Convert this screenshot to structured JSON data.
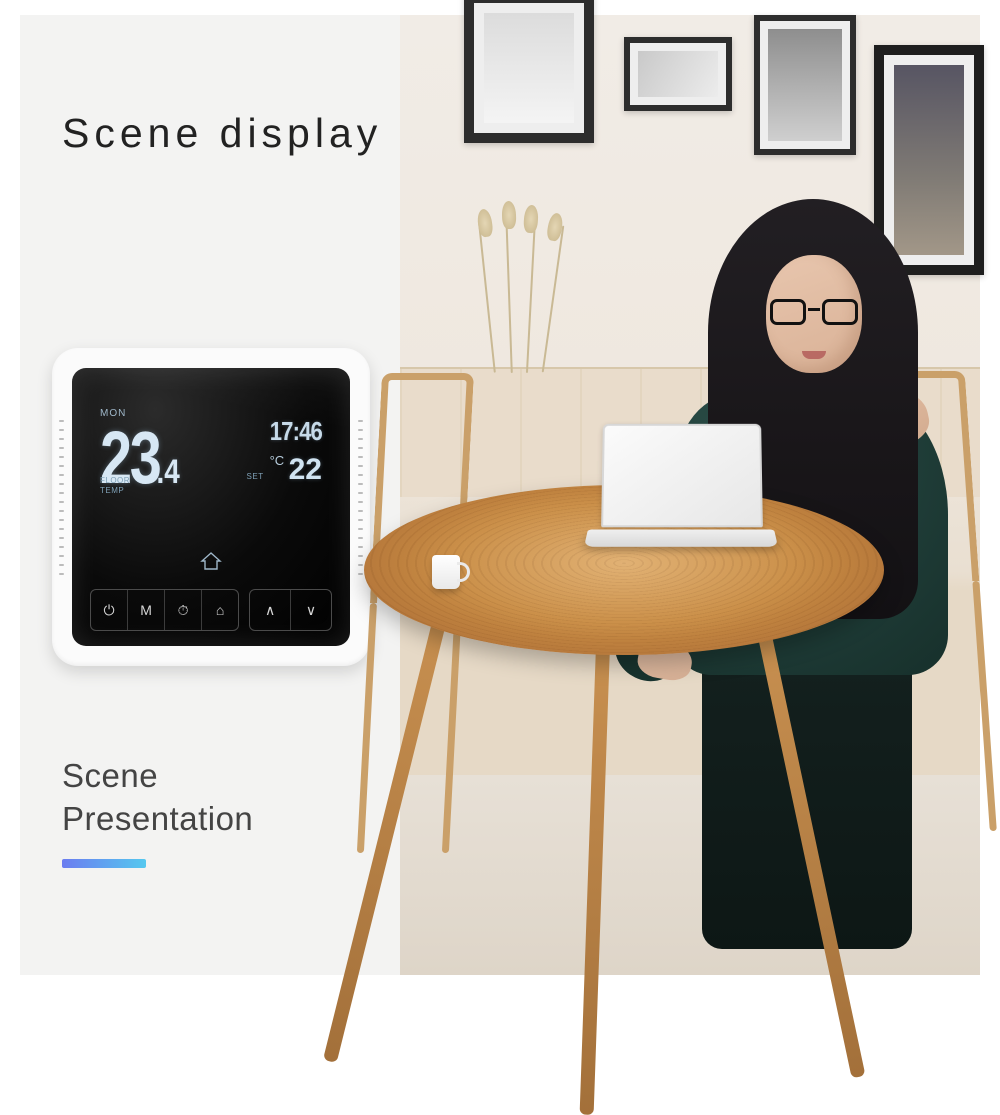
{
  "heading": "Scene display",
  "subtitle_line1": "Scene",
  "subtitle_line2": "Presentation",
  "thermostat": {
    "day": "MON",
    "floor_label_1": "FLOOR",
    "floor_label_2": "TEMP",
    "temp_main": "23",
    "temp_decimal": ".4",
    "clock": "17:46",
    "set_label": "SET",
    "set_temp": "22",
    "unit": "°C",
    "buttons": {
      "power": "⏻",
      "mode": "M",
      "timer": "⏱",
      "home": "⌂",
      "up": "∧",
      "down": "∨"
    }
  }
}
